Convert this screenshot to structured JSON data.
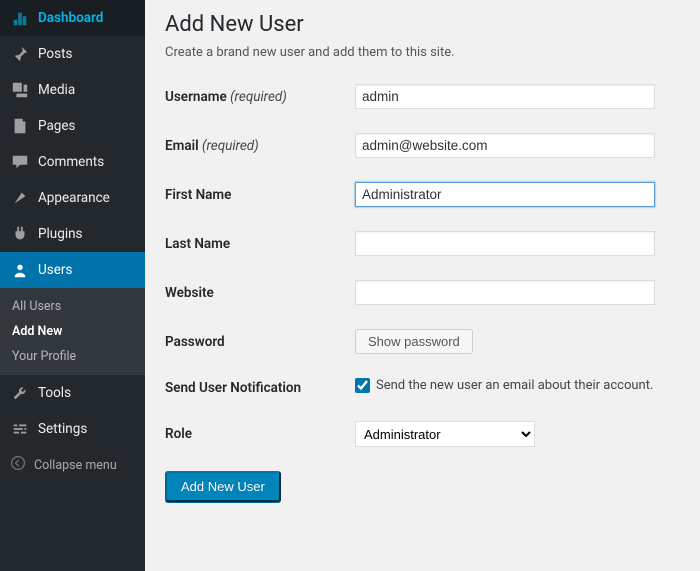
{
  "sidebar": {
    "items": [
      {
        "label": "Dashboard",
        "icon": "dashboard"
      },
      {
        "label": "Posts",
        "icon": "pin"
      },
      {
        "label": "Media",
        "icon": "media"
      },
      {
        "label": "Pages",
        "icon": "pages"
      },
      {
        "label": "Comments",
        "icon": "comments"
      },
      {
        "label": "Appearance",
        "icon": "appearance"
      },
      {
        "label": "Plugins",
        "icon": "plugins"
      },
      {
        "label": "Users",
        "icon": "users",
        "active": true
      },
      {
        "label": "Tools",
        "icon": "tools"
      },
      {
        "label": "Settings",
        "icon": "settings"
      }
    ],
    "submenu": [
      {
        "label": "All Users"
      },
      {
        "label": "Add New",
        "current": true
      },
      {
        "label": "Your Profile"
      }
    ],
    "collapse_label": "Collapse menu"
  },
  "page": {
    "title": "Add New User",
    "subtitle": "Create a brand new user and add them to this site."
  },
  "form": {
    "username": {
      "label": "Username",
      "required": "(required)",
      "value": "admin"
    },
    "email": {
      "label": "Email",
      "required": "(required)",
      "value": "admin@website.com"
    },
    "first_name": {
      "label": "First Name",
      "value": "Administrator"
    },
    "last_name": {
      "label": "Last Name",
      "value": ""
    },
    "website": {
      "label": "Website",
      "value": ""
    },
    "password": {
      "label": "Password",
      "button": "Show password"
    },
    "notification": {
      "label": "Send User Notification",
      "checkbox_label": "Send the new user an email about their account.",
      "checked": true
    },
    "role": {
      "label": "Role",
      "value": "Administrator"
    },
    "submit": "Add New User"
  }
}
